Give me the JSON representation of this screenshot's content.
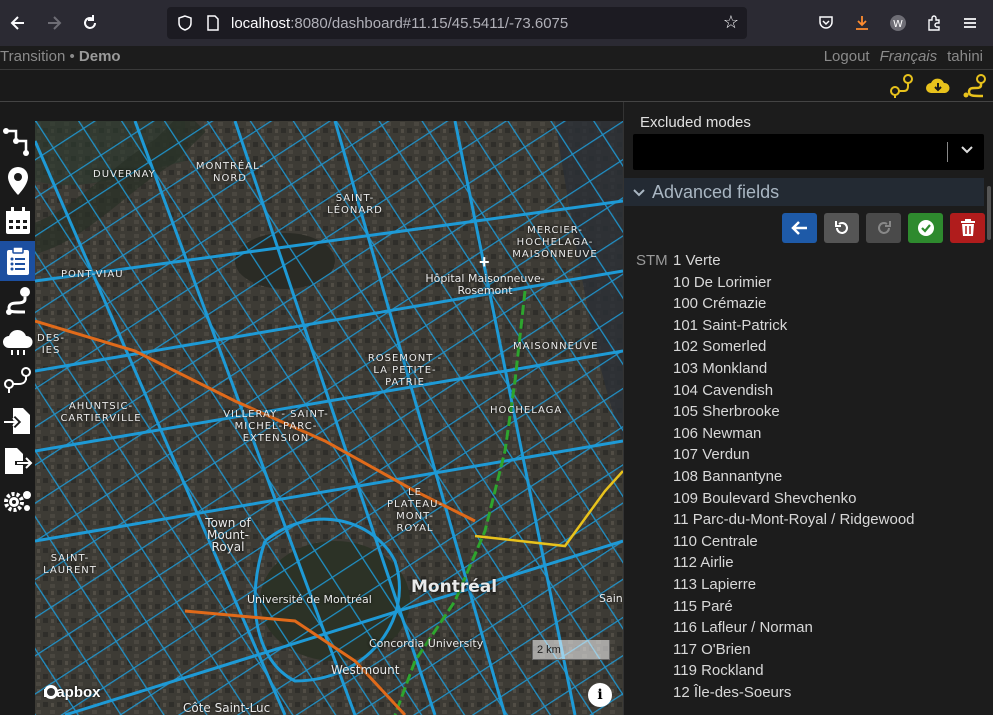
{
  "browser": {
    "url_host": "localhost",
    "url_path": ":8080/dashboard#11.15/45.5411/-73.6075"
  },
  "header": {
    "app_name": "Transition",
    "separator": "•",
    "project": "Demo",
    "logout": "Logout",
    "language": "Français",
    "user": "tahini"
  },
  "map": {
    "labels": [
      "DUVERNAY",
      "MONTRÉAL-NORD",
      "SAINT-LÉONARD",
      "MERCIER-HOCHELAGA-MAISONNEUVE",
      "PONT-VIAU",
      "Hôpital Maisonneuve-Rosemont",
      "MAISONNEUVE",
      "DES-IES",
      "ROSEMONT - LA PETITE-PATRIE",
      "AHUNTSIC-CARTIERVILLE",
      "VILLERAY - SAINT-MICHEL-PARC-EXTENSION",
      "HOCHELAGA",
      "LE PLATEAU-MONT-ROYAL",
      "Town of Mount-Royal",
      "SAINT-LAURENT",
      "Université de Montréal",
      "Montréal",
      "Concordia University",
      "Westmount",
      "Côte Saint-Luc",
      "Sain"
    ],
    "scale": "2 km",
    "attribution": "mapbox"
  },
  "panel": {
    "excluded_modes_label": "Excluded modes",
    "advanced_fields": "Advanced fields",
    "agency": "STM",
    "lines": [
      "1 Verte",
      "10 De Lorimier",
      "100 Crémazie",
      "101 Saint-Patrick",
      "102 Somerled",
      "103 Monkland",
      "104 Cavendish",
      "105 Sherbrooke",
      "106 Newman",
      "107 Verdun",
      "108 Bannantyne",
      "109 Boulevard Shevchenko",
      "11 Parc-du-Mont-Royal / Ridgewood",
      "110 Centrale",
      "112 Airlie",
      "113 Lapierre",
      "115 Paré",
      "116 Lafleur / Norman",
      "117 O'Brien",
      "119 Rockland",
      "12 Île-des-Soeurs"
    ]
  },
  "colors": {
    "accent_blue": "#1e5aa8",
    "network_line": "#1e9ad6",
    "green_line": "#2ea52e",
    "orange_line": "#e06a1a",
    "yellow_line": "#e8c21c",
    "save_green": "#2e8a2e",
    "delete_red": "#b01c1c"
  }
}
